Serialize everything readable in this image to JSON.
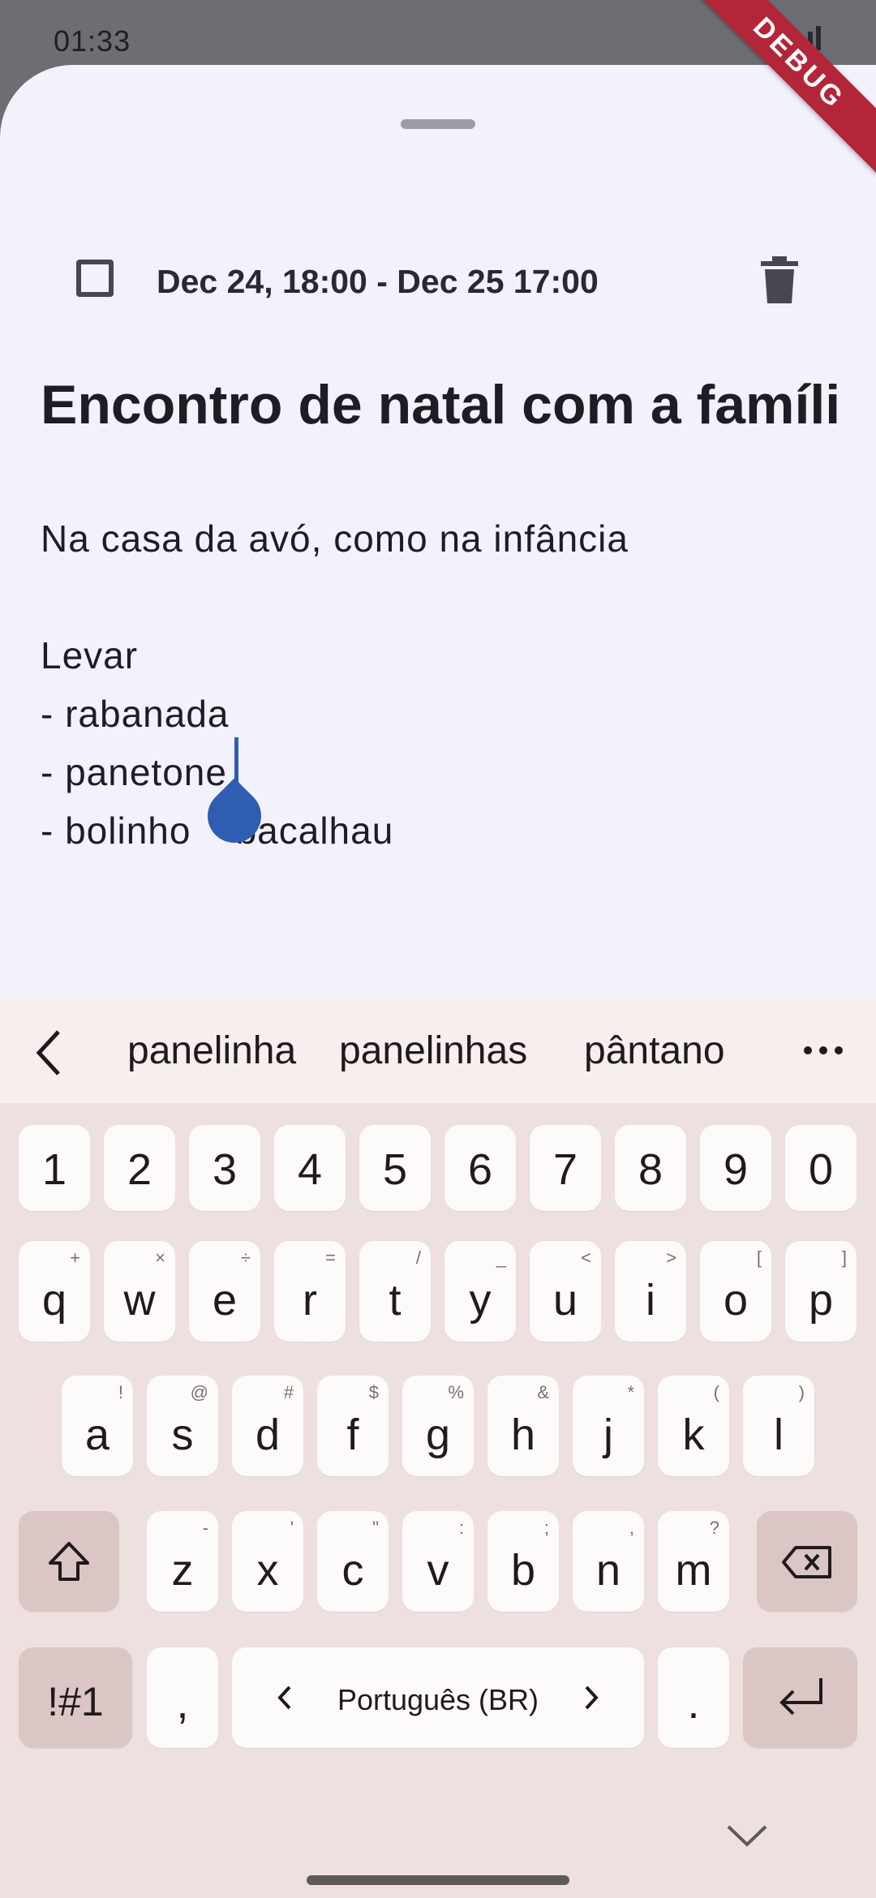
{
  "status_bar": {
    "time": "01:33",
    "debug_label": "DEBUG"
  },
  "note": {
    "date_range": "Dec 24, 18:00 - Dec 25 17:00",
    "title": "Encontro de natal com a famíli",
    "body_lines": [
      "Na casa da avó, como na infância",
      "",
      "Levar",
      "- rabanada",
      "- panetone",
      "- bolinho    bacalhau"
    ]
  },
  "keyboard": {
    "suggestions": [
      "panelinha",
      "panelinhas",
      "pântano"
    ],
    "numbers": [
      "1",
      "2",
      "3",
      "4",
      "5",
      "6",
      "7",
      "8",
      "9",
      "0"
    ],
    "row_qwerty": [
      {
        "k": "q",
        "h": "+"
      },
      {
        "k": "w",
        "h": "×"
      },
      {
        "k": "e",
        "h": "÷"
      },
      {
        "k": "r",
        "h": "="
      },
      {
        "k": "t",
        "h": "/"
      },
      {
        "k": "y",
        "h": "_"
      },
      {
        "k": "u",
        "h": "<"
      },
      {
        "k": "i",
        "h": ">"
      },
      {
        "k": "o",
        "h": "["
      },
      {
        "k": "p",
        "h": "]"
      }
    ],
    "row_asdf": [
      {
        "k": "a",
        "h": "!"
      },
      {
        "k": "s",
        "h": "@"
      },
      {
        "k": "d",
        "h": "#"
      },
      {
        "k": "f",
        "h": "$"
      },
      {
        "k": "g",
        "h": "%"
      },
      {
        "k": "h",
        "h": "&"
      },
      {
        "k": "j",
        "h": "*"
      },
      {
        "k": "k",
        "h": "("
      },
      {
        "k": "l",
        "h": ")"
      }
    ],
    "row_zxcv": [
      {
        "k": "z",
        "h": "-"
      },
      {
        "k": "x",
        "h": "'"
      },
      {
        "k": "c",
        "h": "\""
      },
      {
        "k": "v",
        "h": ":"
      },
      {
        "k": "b",
        "h": ";"
      },
      {
        "k": "n",
        "h": ","
      },
      {
        "k": "m",
        "h": "?"
      }
    ],
    "symbols_key": "!#1",
    "comma_key": ",",
    "space_label": "Português (BR)",
    "period_key": "."
  }
}
